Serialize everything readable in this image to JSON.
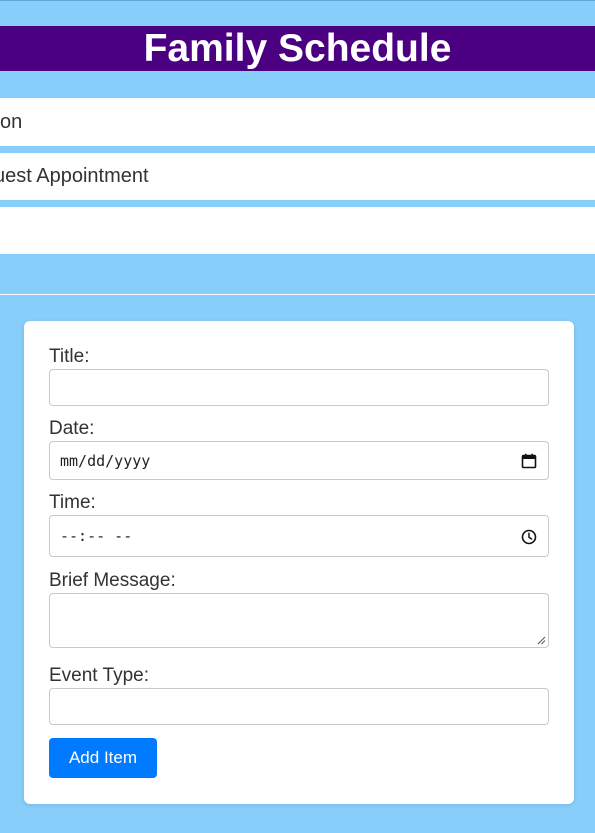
{
  "app": {
    "title": "Family Schedule"
  },
  "list": {
    "items": [
      {
        "label": "on"
      },
      {
        "label": "uest Appointment"
      },
      {
        "label": ""
      }
    ]
  },
  "form": {
    "title_label": "Title:",
    "title_value": "",
    "date_label": "Date:",
    "date_placeholder": "mm/dd/yyyy",
    "time_label": "Time:",
    "time_placeholder": "--:-- --",
    "message_label": "Brief Message:",
    "message_value": "",
    "event_type_label": "Event Type:",
    "event_type_value": "",
    "submit_label": "Add Item"
  },
  "icons": {
    "date": "calendar-icon",
    "time": "clock-icon",
    "resize": "resize-grip-icon"
  },
  "colors": {
    "background": "#87cefa",
    "header": "#4b0082",
    "button": "#007bff"
  }
}
